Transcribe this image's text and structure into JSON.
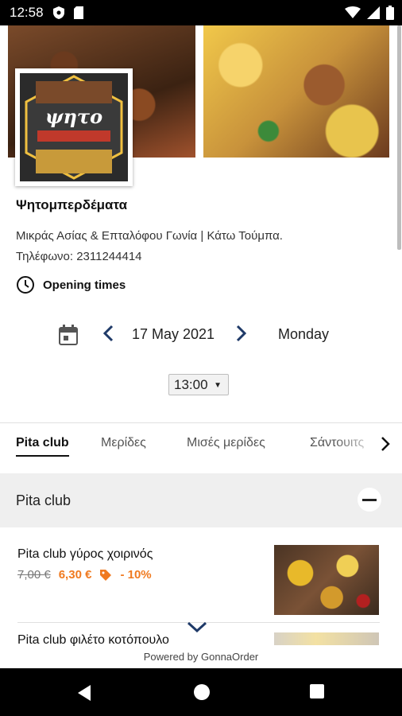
{
  "status_bar": {
    "time": "12:58"
  },
  "store": {
    "name": "Ψητομπερδέματα",
    "address": "Μικράς Ασίας & Επταλόφου Γωνία | Κάτω Τούμπα.",
    "phone": "Τηλέφωνο: 2311244414",
    "opening_times_label": "Opening times",
    "logo_text": "ψητο"
  },
  "date_picker": {
    "date": "17 May 2021",
    "weekday": "Monday"
  },
  "time_select": {
    "value": "13:00"
  },
  "tabs": [
    {
      "label": "Pita club",
      "active": true
    },
    {
      "label": "Μερίδες"
    },
    {
      "label": "Μισές μερίδες"
    },
    {
      "label": "Σάντουιτς"
    }
  ],
  "section": {
    "title": "Pita club"
  },
  "items": [
    {
      "name": "Pita club γύρος χοιρινός",
      "old_price": "7,00 €",
      "new_price": "6,30 €",
      "discount": "- 10%"
    },
    {
      "name": "Pita club φιλέτο κοτόπουλο"
    }
  ],
  "footer": {
    "powered_by": "Powered by GonnaOrder"
  },
  "colors": {
    "accent_navy": "#1f3a68",
    "price_orange": "#f07a20"
  }
}
